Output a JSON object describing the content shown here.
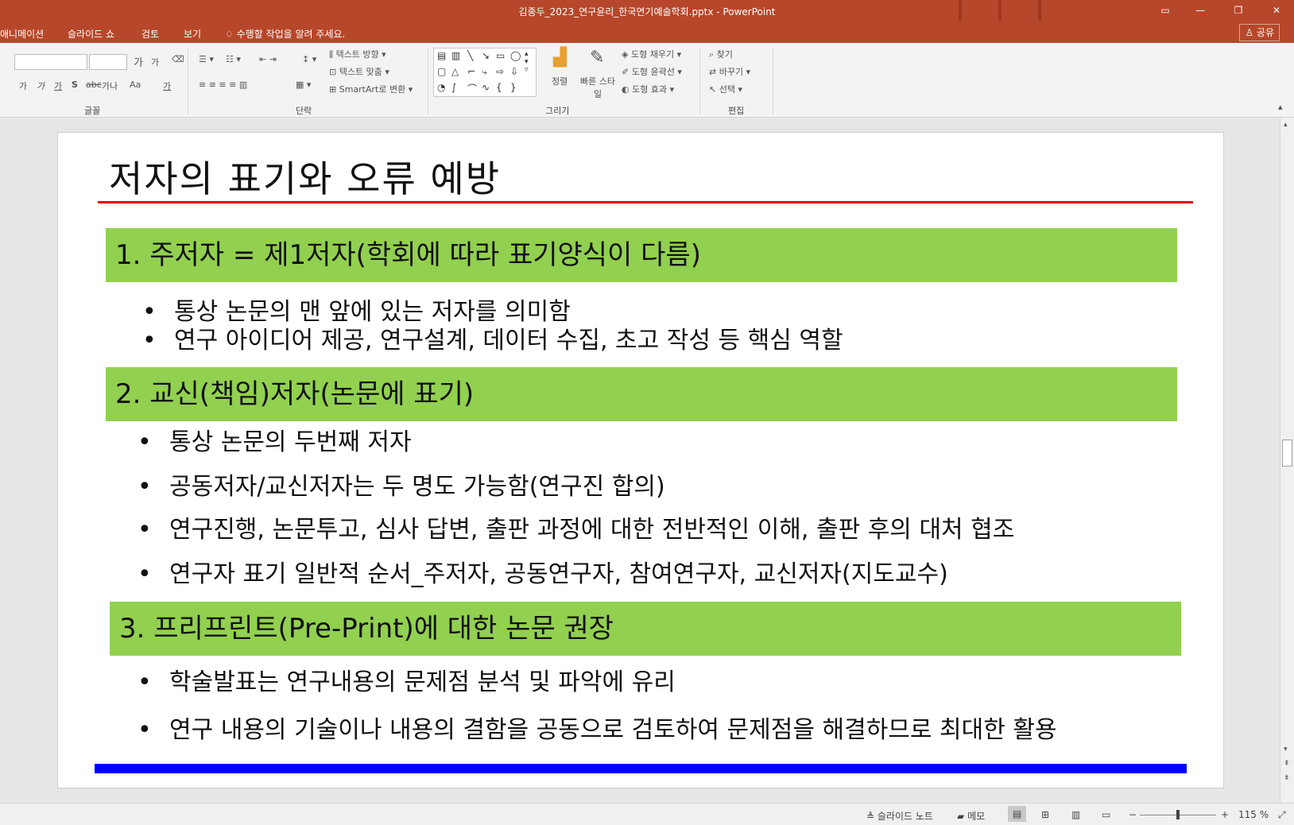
{
  "window": {
    "title": "김종두_2023_연구윤리_한국연기예술학회.pptx  -  PowerPoint",
    "minimize": "—",
    "maximize": "❐",
    "close": "✕"
  },
  "menu": {
    "items": [
      "애니메이션",
      "슬라이드 쇼",
      "검토",
      "보기"
    ],
    "tell_me": "수행할 작업을 알려 주세요.",
    "share": "공유"
  },
  "ribbon": {
    "groups": {
      "font": "글꼴",
      "paragraph": "단락",
      "drawing": "그리기",
      "editing": "편집"
    },
    "text_direction": "텍스트 방향",
    "text_align": "텍스트 맞춤",
    "smartart": "SmartArt로 변환",
    "arrange": "정렬",
    "quick_styles": "빠른 스타일",
    "shape_fill": "도형 채우기",
    "shape_outline": "도형 윤곽선",
    "shape_effects": "도형 효과",
    "find": "찾기",
    "replace": "바꾸기",
    "select": "선택",
    "font_grow": "가",
    "font_shrink": "가",
    "bold": "가",
    "italic": "가",
    "underline": "가",
    "strike": "S",
    "spacing": "가나",
    "case": "Aa",
    "clear": "가"
  },
  "slide": {
    "title": "저자의 표기와 오류 예방",
    "section1": "1. 주저자 = 제1저자(학회에 따라 표기양식이 다름)",
    "section1_bullets": [
      "통상 논문의 맨 앞에 있는 저자를 의미함",
      "연구 아이디어 제공, 연구설계, 데이터 수집, 초고 작성 등 핵심 역할"
    ],
    "section2": "2. 교신(책임)저자(논문에 표기)",
    "section2_bullets": [
      "통상 논문의 두번째 저자",
      "공동저자/교신저자는 두 명도 가능함(연구진 합의)",
      "연구진행, 논문투고, 심사 답변, 출판 과정에 대한 전반적인 이해, 출판 후의 대처 협조",
      "연구자 표기 일반적 순서_주저자, 공동연구자, 참여연구자, 교신저자(지도교수)"
    ],
    "section3": "3. 프리프린트(Pre-Print)에 대한 논문 권장",
    "section3_bullets": [
      "학술발표는 연구내용의 문제점 분석 및 파악에 유리",
      "연구 내용의 기술이나 내용의 결함을 공동으로 검토하여 문제점을 해결하므로 최대한 활용"
    ],
    "bullet_char": "•"
  },
  "status": {
    "notes": "슬라이드 노트",
    "comments": "메모",
    "zoom": "115 %",
    "zoom_out": "−",
    "zoom_in": "+"
  },
  "colors": {
    "accent": "#b7472a",
    "band": "#92d050",
    "title_rule": "#e00000",
    "bottom_rule": "#0000ff"
  }
}
